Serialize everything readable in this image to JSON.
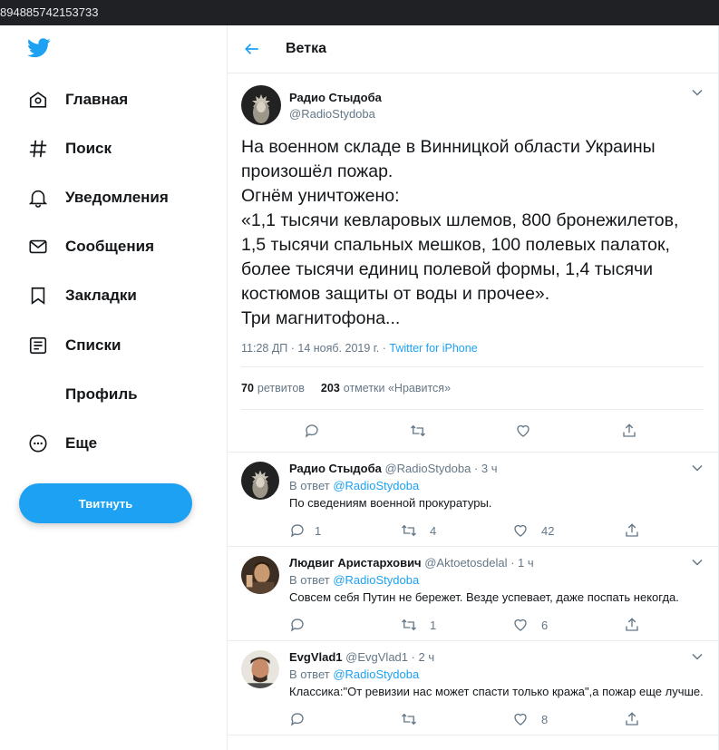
{
  "browser": {
    "url_fragment": "894885742153733"
  },
  "colors": {
    "accent": "#1da1f2",
    "text": "#14171a",
    "muted": "#657786",
    "border": "#e6ecf0"
  },
  "sidebar": {
    "logo_icon": "twitter-bird-icon",
    "items": [
      {
        "label": "Главная",
        "icon": "home-icon"
      },
      {
        "label": "Поиск",
        "icon": "hashtag-icon"
      },
      {
        "label": "Уведомления",
        "icon": "bell-icon"
      },
      {
        "label": "Сообщения",
        "icon": "envelope-icon"
      },
      {
        "label": "Закладки",
        "icon": "bookmark-icon"
      },
      {
        "label": "Списки",
        "icon": "list-icon"
      },
      {
        "label": "Профиль",
        "icon": "profile-icon"
      },
      {
        "label": "Еще",
        "icon": "more-icon"
      }
    ],
    "tweet_button": "Твитнуть"
  },
  "header": {
    "title": "Ветка"
  },
  "focal_tweet": {
    "author_name": "Радио Стыдоба",
    "author_handle": "@RadioStydoba",
    "text": "На военном складе в Винницкой области Украины\nпроизошёл пожар.\nОгнём уничтожено:\n«1,1 тысячи кевларовых шлемов, 800 бронежилетов,\n1,5 тысячи спальных мешков, 100 полевых палаток,\nболее тысячи единиц полевой формы, 1,4 тысячи\nкостюмов защиты от воды и прочее».\nТри магнитофона...",
    "time": "11:28 ДП · 14 нояб. 2019 г. · ",
    "source": "Twitter for iPhone",
    "retweets_count": "70",
    "retweets_label": "ретвитов",
    "likes_count": "203",
    "likes_label": "отметки «Нравится»"
  },
  "replies": [
    {
      "name": "Радио Стыдоба",
      "handle": "@RadioStydoba · 3 ч",
      "reply_prefix": "В ответ ",
      "reply_to": "@RadioStydoba",
      "text": "По сведениям военной прокуратуры.",
      "counts": {
        "reply": "1",
        "retweet": "4",
        "like": "42"
      }
    },
    {
      "name": "Людвиг Аристархович",
      "handle": "@Aktoetosdelal · 1 ч",
      "reply_prefix": "В ответ ",
      "reply_to": "@RadioStydoba",
      "text": "Совсем себя Путин не бережет. Везде успевает, даже поспать некогда.",
      "counts": {
        "reply": "",
        "retweet": "1",
        "like": "6"
      }
    },
    {
      "name": "EvgVlad1",
      "handle": "@EvgVlad1 · 2 ч",
      "reply_prefix": "В ответ ",
      "reply_to": "@RadioStydoba",
      "text": "Классика:\"От ревизии нас может спасти только кража\",а пожар еще лучше.",
      "counts": {
        "reply": "",
        "retweet": "",
        "like": "8"
      }
    }
  ]
}
